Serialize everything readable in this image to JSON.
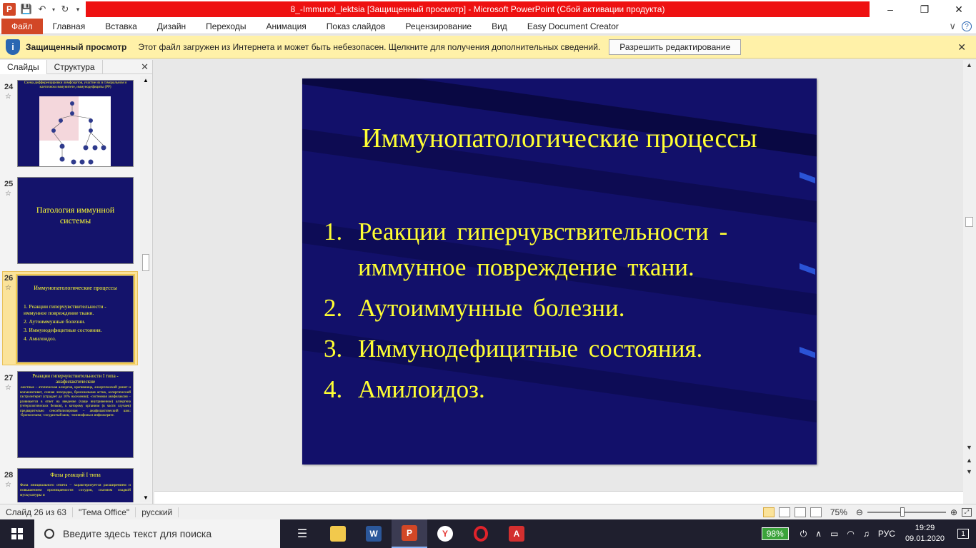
{
  "app": {
    "window_title": "8_-Immunol_lektsia [Защищенный просмотр]  -  Microsoft PowerPoint (Сбой активации продукта)",
    "app_icon_letter": "P"
  },
  "ribbon": {
    "tabs": [
      "Файл",
      "Главная",
      "Вставка",
      "Дизайн",
      "Переходы",
      "Анимация",
      "Показ слайдов",
      "Рецензирование",
      "Вид",
      "Easy Document Creator"
    ]
  },
  "protected_view": {
    "title": "Защищенный просмотр",
    "message": "Этот файл загружен из Интернета и может быть небезопасен. Щелкните для получения дополнительных сведений.",
    "button": "Разрешить редактирование"
  },
  "left_pane": {
    "tabs": [
      "Слайды",
      "Структура"
    ],
    "thumbnails": [
      {
        "num": "24",
        "title": "Схема дифференцировки лимфоцитов, участие их в гуморальном и клеточном иммунитете, иммунодефициты (РР)"
      },
      {
        "num": "25",
        "title": "Патология иммунной системы"
      },
      {
        "num": "26",
        "title": "Иммунопатологические процессы",
        "items": [
          "1. Реакции гиперчувствительности - иммунное повреждение ткани.",
          "2. Аутоиммунные болезни.",
          "3. Иммунодефицитные состояния.",
          "4. Амилоидоз."
        ]
      },
      {
        "num": "27",
        "title": "Реакции гиперчувствительности I типа - анафилактические",
        "text": "-местные – атопическая аллергия, крапивница, аллергический ринит и конъюнктивит, сенная лихорадка, бронхиальная астма, аллергический гастроэнтерит (страдает до 10% населения); -системная анафилаксия – развивается в ответ на введение (чаще внутривенное) аллергена (гетерологических белков), к которому организм (в части случаев) предварительно сенсибилизирован – анафилактический шок: -бронхоспазм; -сосудистый шок; -эозинофилы в инфильтрате."
      },
      {
        "num": "28",
        "title": "Фазы реакций I типа",
        "text": "Фаза инициального ответа – характеризуется расширением и повышением проницаемости сосудов, спазмом гладкой мускулатуры и"
      }
    ]
  },
  "slide": {
    "title": "Иммунопатологические процессы",
    "items": [
      {
        "num": "1.",
        "text": "Реакции гиперчувствительности - иммунное повреждение ткани."
      },
      {
        "num": "2.",
        "text": "Аутоиммунные болезни."
      },
      {
        "num": "3.",
        "text": "Иммунодефицитные состояния."
      },
      {
        "num": "4.",
        "text": "Амилоидоз."
      }
    ]
  },
  "status": {
    "slide_of": "Слайд 26 из 63",
    "theme": "\"Тема Office\"",
    "language": "русский",
    "zoom": "75%"
  },
  "taskbar": {
    "search_placeholder": "Введите здесь текст для поиска",
    "battery": "98%",
    "lang": "РУС",
    "time": "19:29",
    "date": "09.01.2020",
    "notifications": "1"
  },
  "colors": {
    "accent": "#d24726",
    "title_bar_red": "#ee1111",
    "slide_bg": "#12106a",
    "slide_text": "#ffff33"
  }
}
